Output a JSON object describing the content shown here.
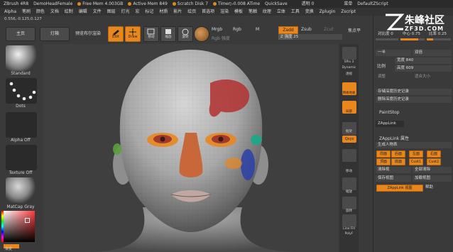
{
  "topbar": {
    "app": "ZBrush 4R8",
    "doc": "DemoHeadFemale",
    "free_mem": "Free Mem 4.003GB",
    "active_mem": "Active Mem 849",
    "scratch": "Scratch Disk 7",
    "timer": "Timer▷0.008 ATime",
    "quicksave": "QuickSave",
    "transparency": "透明 0",
    "menus": "菜单",
    "script": "DefaultZScript"
  },
  "menubar": [
    "Alpha",
    "笔刷",
    "颜色",
    "文档",
    "绘制",
    "编辑",
    "文件",
    "图层",
    "灯光",
    "宏",
    "标记",
    "材质",
    "影片",
    "绘页",
    "首选项",
    "渲染",
    "模板",
    "笔触",
    "纹理",
    "立体",
    "工具",
    "变换",
    "Zplugin",
    "Zscript"
  ],
  "coords": "0.556,-0.125,0.127",
  "toolbar": {
    "home": "主页",
    "lightbox": "灯箱",
    "preview_render": "预览布尔渲染",
    "edit": "Edit",
    "draw": "Draw",
    "move": "移动",
    "scale": "缩放",
    "rotate": "旋转",
    "mrgb": "Mrgb",
    "rgb": "Rgb",
    "m": "M",
    "rgb_intensity": "Rgb 强度",
    "zadd": "Zadd",
    "zsub": "Zsub",
    "zcut": "Zcut",
    "z_intensity": "Z 强度 25",
    "focal": "焦点平"
  },
  "left": {
    "standard": "Standard",
    "dots": "Dots",
    "alpha_off": "Alpha Off",
    "texture_off": "Texture Off",
    "matcap": "MatCap Gray",
    "gradient": "渐变"
  },
  "shelf": {
    "spix": "SPix 3",
    "dynamic": "Dynamic",
    "persp": "透视",
    "floor": "网格地板",
    "local": "局部",
    "frame": "框架",
    "xyz": "Qxyz",
    "move": "移动",
    "scale": "缩放",
    "rotate": "旋转",
    "linefill": "Line Fill",
    "polyf": "PolyF"
  },
  "panel": {
    "contrast": "对比度 0",
    "center": "中心 0.75",
    "ratio": "比率 0.25",
    "half": "一半",
    "double": "双倍",
    "width": "宽度 840",
    "height": "高度 609",
    "ratio_label": "比例",
    "adjust": "调整",
    "fit": "适合大小",
    "save_depth": "存储深度历史记录",
    "delete_depth": "删除深度历史记录",
    "paintstop": "PaintStop",
    "zapplink": "ZAppLink",
    "zapplink_props": "ZAppLink 属性",
    "gen_person": "生成人物表",
    "views": [
      "前面",
      "后面",
      "左面",
      "右面",
      "顶面",
      "底面",
      "Cust1",
      "Cust2"
    ],
    "clear": "清除视",
    "clear_all": "全部清除",
    "save_view": "保存视图",
    "load_view": "加载视图",
    "zapplink_view": "ZAppLink 视图",
    "help": "帮助"
  },
  "watermark": {
    "title": "朱峰社区",
    "url": "ZF3D.COM"
  }
}
